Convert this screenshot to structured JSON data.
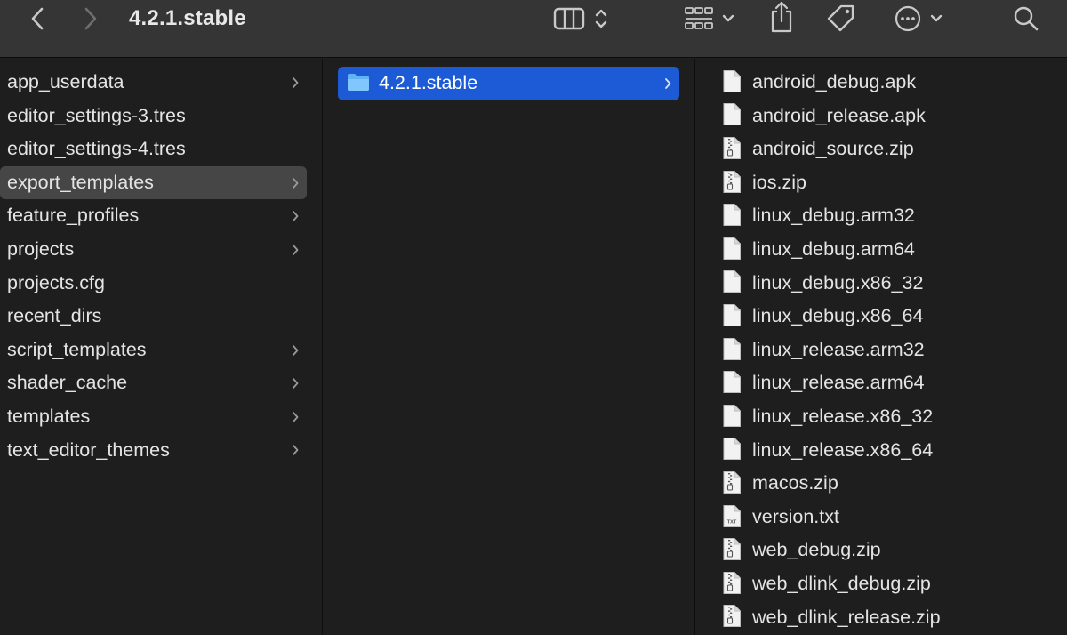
{
  "window": {
    "title": "4.2.1.stable"
  },
  "colors": {
    "toolbar_bg": "#353536",
    "content_bg": "#1e1e1e",
    "selection_active": "#1d5bd6",
    "selection_inactive": "#464647",
    "folder_blue": "#62b3f4",
    "text": "#e4e4e4"
  },
  "toolbar": {
    "back_icon": "chevron-left-icon",
    "forward_icon": "chevron-right-icon",
    "view_icon": "column-view-icon",
    "group_icon": "grid-icon",
    "share_icon": "share-icon",
    "tag_icon": "tag-icon",
    "more_icon": "ellipsis-circle-icon",
    "search_icon": "search-icon"
  },
  "column1": {
    "items": [
      {
        "name": "app_userdata",
        "is_folder": true
      },
      {
        "name": "editor_settings-3.tres",
        "is_folder": false
      },
      {
        "name": "editor_settings-4.tres",
        "is_folder": false
      },
      {
        "name": "export_templates",
        "is_folder": true,
        "selected": true
      },
      {
        "name": "feature_profiles",
        "is_folder": true
      },
      {
        "name": "projects",
        "is_folder": true
      },
      {
        "name": "projects.cfg",
        "is_folder": false
      },
      {
        "name": "recent_dirs",
        "is_folder": false
      },
      {
        "name": "script_templates",
        "is_folder": true
      },
      {
        "name": "shader_cache",
        "is_folder": true
      },
      {
        "name": "templates",
        "is_folder": true
      },
      {
        "name": "text_editor_themes",
        "is_folder": true
      }
    ]
  },
  "column2": {
    "items": [
      {
        "name": "4.2.1.stable",
        "is_folder": true,
        "selected": true
      }
    ]
  },
  "column3": {
    "items": [
      {
        "name": "android_debug.apk",
        "icon": "document-icon"
      },
      {
        "name": "android_release.apk",
        "icon": "document-icon"
      },
      {
        "name": "android_source.zip",
        "icon": "zip-icon"
      },
      {
        "name": "ios.zip",
        "icon": "zip-icon"
      },
      {
        "name": "linux_debug.arm32",
        "icon": "document-icon"
      },
      {
        "name": "linux_debug.arm64",
        "icon": "document-icon"
      },
      {
        "name": "linux_debug.x86_32",
        "icon": "document-icon"
      },
      {
        "name": "linux_debug.x86_64",
        "icon": "document-icon"
      },
      {
        "name": "linux_release.arm32",
        "icon": "document-icon"
      },
      {
        "name": "linux_release.arm64",
        "icon": "document-icon"
      },
      {
        "name": "linux_release.x86_32",
        "icon": "document-icon"
      },
      {
        "name": "linux_release.x86_64",
        "icon": "document-icon"
      },
      {
        "name": "macos.zip",
        "icon": "zip-icon"
      },
      {
        "name": "version.txt",
        "icon": "txt-icon",
        "icon_label": "TXT"
      },
      {
        "name": "web_debug.zip",
        "icon": "zip-icon"
      },
      {
        "name": "web_dlink_debug.zip",
        "icon": "zip-icon"
      },
      {
        "name": "web_dlink_release.zip",
        "icon": "zip-icon"
      }
    ]
  }
}
